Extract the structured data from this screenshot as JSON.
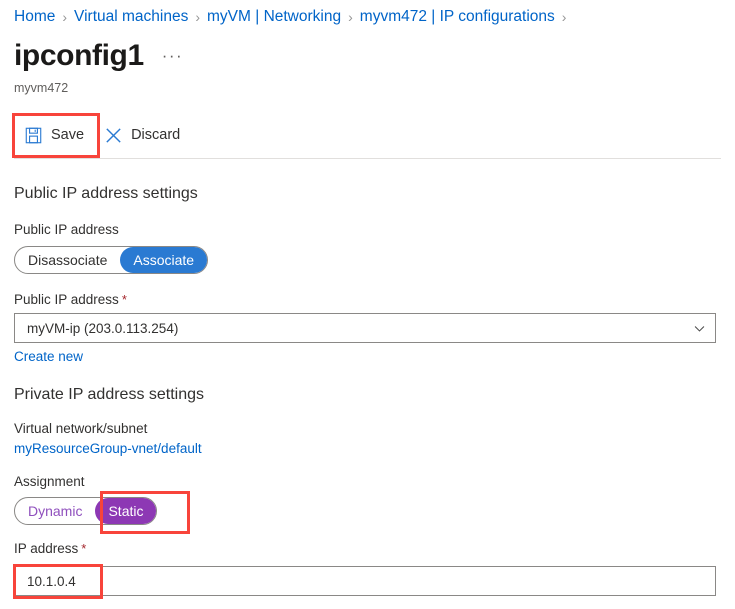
{
  "breadcrumb": {
    "items": [
      {
        "label": "Home"
      },
      {
        "label": "Virtual machines"
      },
      {
        "label": "myVM | Networking"
      },
      {
        "label": "myvm472 | IP configurations"
      }
    ],
    "separator": "›"
  },
  "header": {
    "title": "ipconfig1",
    "ellipsis": "···",
    "subtitle": "myvm472"
  },
  "toolbar": {
    "save_label": "Save",
    "save_icon": "save-floppy-icon",
    "discard_label": "Discard",
    "discard_icon": "close-x-icon"
  },
  "public_section": {
    "heading": "Public IP address settings",
    "toggle_label": "Public IP address",
    "toggle_options": [
      {
        "label": "Disassociate",
        "selected": false
      },
      {
        "label": "Associate",
        "selected": true
      }
    ],
    "dropdown_label": "Public IP address",
    "dropdown_required": "*",
    "dropdown_value": "myVM-ip (203.0.113.254)",
    "dropdown_icon": "chevron-down-icon",
    "create_new_link": "Create new"
  },
  "private_section": {
    "heading": "Private IP address settings",
    "vnet_label": "Virtual network/subnet",
    "vnet_link": "myResourceGroup-vnet/default",
    "assignment_label": "Assignment",
    "assignment_options": [
      {
        "label": "Dynamic",
        "selected": false
      },
      {
        "label": "Static",
        "selected": true
      }
    ],
    "ip_label": "IP address",
    "ip_required": "*",
    "ip_value": "10.1.0.4",
    "ip_placeholder": ""
  },
  "colors": {
    "link_blue": "#0064c8",
    "accent_blue": "#2a7ad2",
    "accent_purple": "#8d38b4",
    "purple_text": "#8f4fbd",
    "required_red": "#a4262c",
    "annotation_red": "#f8443b",
    "border_gray": "#8a8886",
    "divider_gray": "#e1dfdd"
  }
}
